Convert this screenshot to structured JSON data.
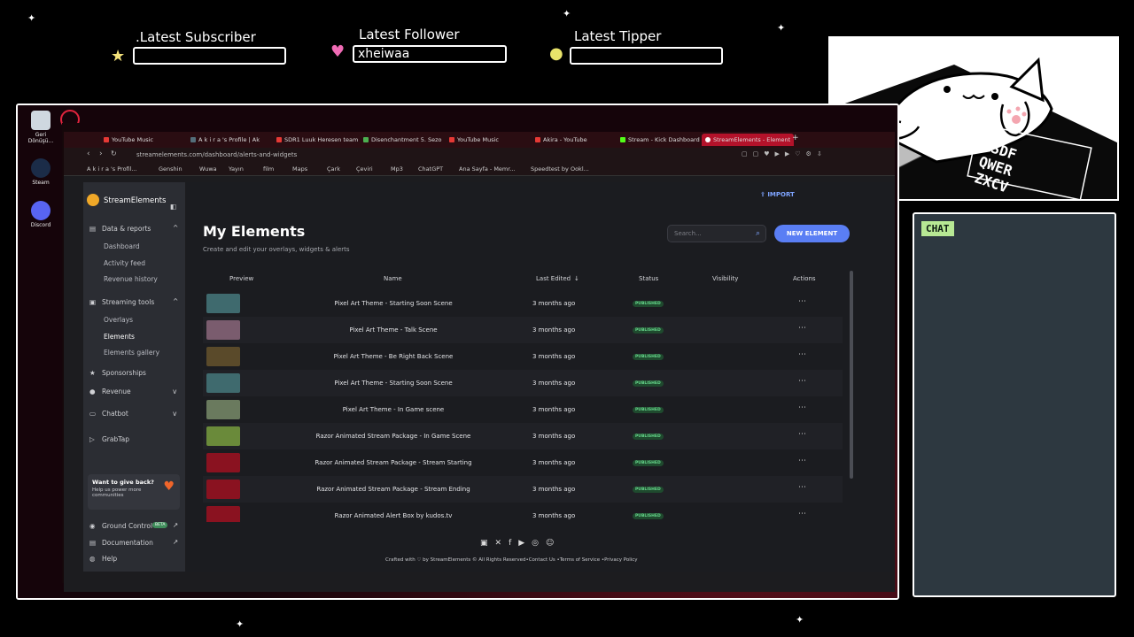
{
  "alerts": {
    "subscriber": {
      "title": ".Latest Subscriber",
      "value": ""
    },
    "follower": {
      "title": "Latest Follower",
      "value": "xheiwaa"
    },
    "tipper": {
      "title": "Latest Tipper",
      "value": ""
    }
  },
  "chat": {
    "label": "CHAT"
  },
  "cam": {
    "keys": [
      "ASDF",
      "QWER",
      "ZXCV"
    ]
  },
  "desktop": [
    {
      "label": "Geri Dönüşü...",
      "icon": "recycle-bin-icon"
    },
    {
      "label": "Steam",
      "icon": "steam-icon"
    },
    {
      "label": "Discord",
      "icon": "discord-icon"
    }
  ],
  "browser": {
    "tabs": [
      "YouTube Music",
      "A k i r a 's Profile | Ak",
      "SDR1 Luuk Heresen team",
      "Disenchantment 5. Sezo",
      "YouTube Music",
      "Akira - YouTube",
      "Stream - Kick Dashboard",
      "StreamElements - Element"
    ],
    "url": "streamelements.com/dashboard/alerts-and-widgets",
    "bookmarks": [
      "A k i r a 's Profil...",
      "Genshin",
      "Wuwa",
      "Yayın",
      "film",
      "Maps",
      "Çark",
      "Çeviri",
      "Mp3",
      "ChatGPT",
      "Ana Sayfa - Memr...",
      "Speedtest by Ookl..."
    ]
  },
  "sidebar": {
    "brand": "StreamElements",
    "data_reports": "Data & reports",
    "dashboard": "Dashboard",
    "activity_feed": "Activity feed",
    "revenue_history": "Revenue history",
    "streaming_tools": "Streaming tools",
    "overlays": "Overlays",
    "elements": "Elements",
    "elements_gallery": "Elements gallery",
    "sponsorships": "Sponsorships",
    "revenue": "Revenue",
    "chatbot": "Chatbot",
    "grabtap": "GrabTap",
    "give_title": "Want to give back?",
    "give_body": "Help us power more communities",
    "ground_control": "Ground Control",
    "beta": "BETA",
    "documentation": "Documentation",
    "help": "Help"
  },
  "main": {
    "import": "IMPORT",
    "title": "My Elements",
    "subtitle": "Create and edit your overlays, widgets & alerts",
    "search_placeholder": "Search...",
    "new_element": "NEW ELEMENT",
    "columns": {
      "preview": "Preview",
      "name": "Name",
      "last_edited": "Last Edited",
      "status": "Status",
      "visibility": "Visibility",
      "actions": "Actions"
    },
    "rows": [
      {
        "name": "Pixel Art Theme - Starting Soon Scene",
        "edited": "3 months ago",
        "status": "PUBLISHED"
      },
      {
        "name": "Pixel Art Theme - Talk Scene",
        "edited": "3 months ago",
        "status": "PUBLISHED"
      },
      {
        "name": "Pixel Art Theme - Be Right Back Scene",
        "edited": "3 months ago",
        "status": "PUBLISHED"
      },
      {
        "name": "Pixel Art Theme - Starting Soon Scene",
        "edited": "3 months ago",
        "status": "PUBLISHED"
      },
      {
        "name": "Pixel Art Theme - In Game scene",
        "edited": "3 months ago",
        "status": "PUBLISHED"
      },
      {
        "name": "Razor Animated Stream Package - In Game Scene",
        "edited": "3 months ago",
        "status": "PUBLISHED"
      },
      {
        "name": "Razor Animated Stream Package - Stream Starting",
        "edited": "3 months ago",
        "status": "PUBLISHED"
      },
      {
        "name": "Razor Animated Stream Package - Stream Ending",
        "edited": "3 months ago",
        "status": "PUBLISHED"
      },
      {
        "name": "Razor Animated Alert Box by kudos.tv",
        "edited": "3 months ago",
        "status": "PUBLISHED"
      }
    ],
    "footer": "Crafted with ♡ by  StreamElements © All Rights Reserved•Contact Us  •Terms of Service  •Privacy Policy"
  },
  "colors": {
    "accent": "#5a7ef4",
    "published": "#67d78c",
    "active_tab": "#b3122a"
  }
}
